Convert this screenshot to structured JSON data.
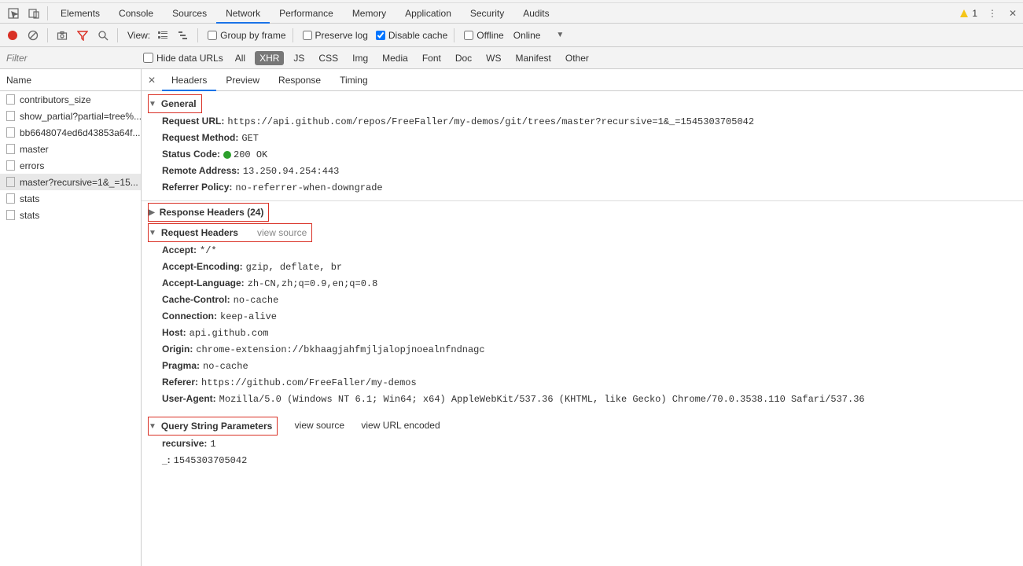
{
  "tabs": {
    "items": [
      "Elements",
      "Console",
      "Sources",
      "Network",
      "Performance",
      "Memory",
      "Application",
      "Security",
      "Audits"
    ],
    "active": "Network",
    "warn_count": "1"
  },
  "toolbar": {
    "view_label": "View:",
    "group_by_frame": "Group by frame",
    "preserve_log": "Preserve log",
    "disable_cache": "Disable cache",
    "offline": "Offline",
    "online": "Online"
  },
  "filterbar": {
    "filter_placeholder": "Filter",
    "hide_data_urls": "Hide data URLs",
    "types": [
      "All",
      "XHR",
      "JS",
      "CSS",
      "Img",
      "Media",
      "Font",
      "Doc",
      "WS",
      "Manifest",
      "Other"
    ],
    "selected_type": "XHR"
  },
  "requests": {
    "header": "Name",
    "items": [
      "contributors_size",
      "show_partial?partial=tree%...",
      "bb6648074ed6d43853a64f...",
      "master",
      "errors",
      "master?recursive=1&_=15...",
      "stats",
      "stats"
    ],
    "selected_index": 5
  },
  "detail_tabs": {
    "items": [
      "Headers",
      "Preview",
      "Response",
      "Timing"
    ],
    "active": "Headers"
  },
  "sections": {
    "general": {
      "title": "General",
      "request_url_k": "Request URL:",
      "request_url_v": "https://api.github.com/repos/FreeFaller/my-demos/git/trees/master?recursive=1&_=1545303705042",
      "request_method_k": "Request Method:",
      "request_method_v": "GET",
      "status_code_k": "Status Code:",
      "status_code_v": "200 OK",
      "remote_addr_k": "Remote Address:",
      "remote_addr_v": "13.250.94.254:443",
      "referrer_policy_k": "Referrer Policy:",
      "referrer_policy_v": "no-referrer-when-downgrade"
    },
    "response_headers": {
      "title": "Response Headers (24)"
    },
    "request_headers": {
      "title": "Request Headers",
      "view_source": "view source",
      "rows": [
        {
          "k": "Accept:",
          "v": "*/*"
        },
        {
          "k": "Accept-Encoding:",
          "v": "gzip, deflate, br"
        },
        {
          "k": "Accept-Language:",
          "v": "zh-CN,zh;q=0.9,en;q=0.8"
        },
        {
          "k": "Cache-Control:",
          "v": "no-cache"
        },
        {
          "k": "Connection:",
          "v": "keep-alive"
        },
        {
          "k": "Host:",
          "v": "api.github.com"
        },
        {
          "k": "Origin:",
          "v": "chrome-extension://bkhaagjahfmjljalopjnoealnfndnagc"
        },
        {
          "k": "Pragma:",
          "v": "no-cache"
        },
        {
          "k": "Referer:",
          "v": "https://github.com/FreeFaller/my-demos"
        },
        {
          "k": "User-Agent:",
          "v": "Mozilla/5.0 (Windows NT 6.1; Win64; x64) AppleWebKit/537.36 (KHTML, like Gecko) Chrome/70.0.3538.110 Safari/537.36"
        }
      ]
    },
    "query_params": {
      "title": "Query String Parameters",
      "view_source": "view source",
      "view_url_encoded": "view URL encoded",
      "rows": [
        {
          "k": "recursive:",
          "v": "1"
        },
        {
          "k": "_:",
          "v": "1545303705042"
        }
      ]
    }
  }
}
